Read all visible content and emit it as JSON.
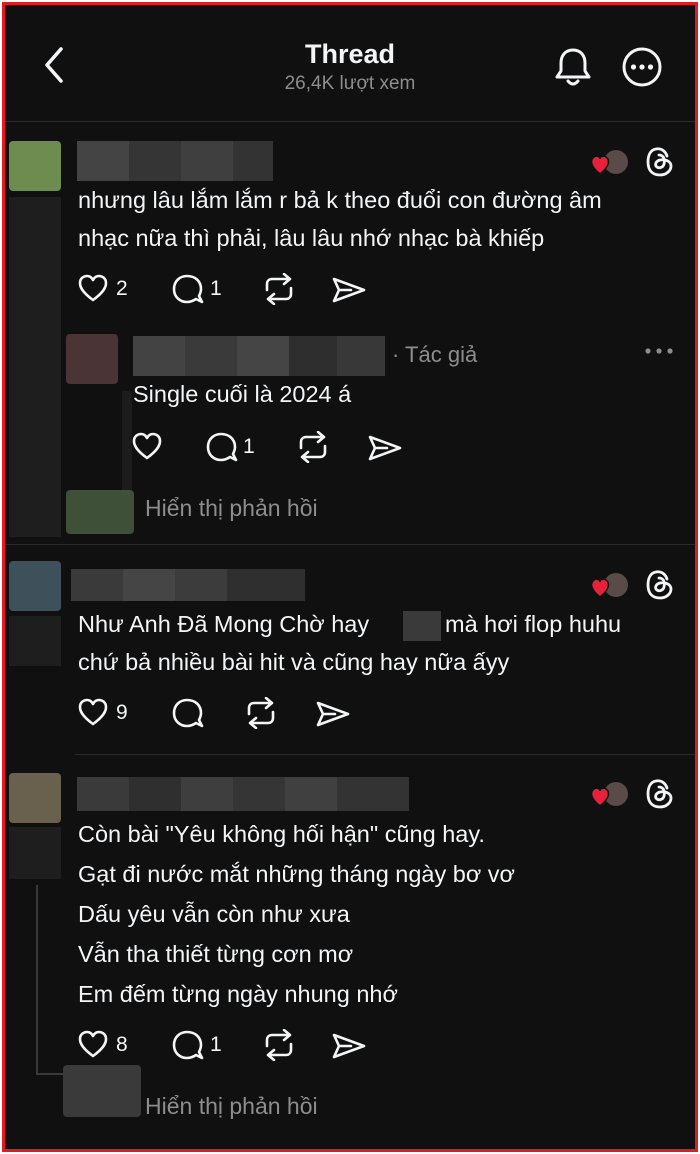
{
  "header": {
    "title": "Thread",
    "views": "26,4K lượt xem"
  },
  "posts": [
    {
      "lines": [
        "nhưng lâu lắm lắm r bả k theo đuổi con đường âm",
        "nhạc nữa thì phải, lâu lâu nhớ nhạc bà khiếp"
      ],
      "likes": "2",
      "replies": "1",
      "reply": {
        "author_tag": "· Tác giả",
        "line": "Single cuối là 2024 á",
        "replies": "1"
      },
      "show_replies": "Hiển thị phản hồi"
    },
    {
      "line1_before": "Như Anh Đã Mong Chờ hay",
      "line1_after": "mà hơi flop huhu",
      "line2": "chứ bả nhiều bài hit và cũng hay nữa ấyy",
      "likes": "9"
    },
    {
      "lines": [
        "Còn bài \"Yêu không hối hận\" cũng hay.",
        "Gạt đi nước mắt những tháng ngày bơ vơ",
        "Dấu yêu vẫn còn như xưa",
        "Vẫn tha thiết từng cơn mơ",
        "Em đếm từng ngày nhung nhớ"
      ],
      "likes": "8",
      "replies": "1",
      "show_replies": "Hiển thị phản hồi"
    }
  ],
  "colors": {
    "background": "#101010",
    "border": "#e21b23",
    "muted": "#8d8d8d",
    "heart": "#e8213a"
  }
}
